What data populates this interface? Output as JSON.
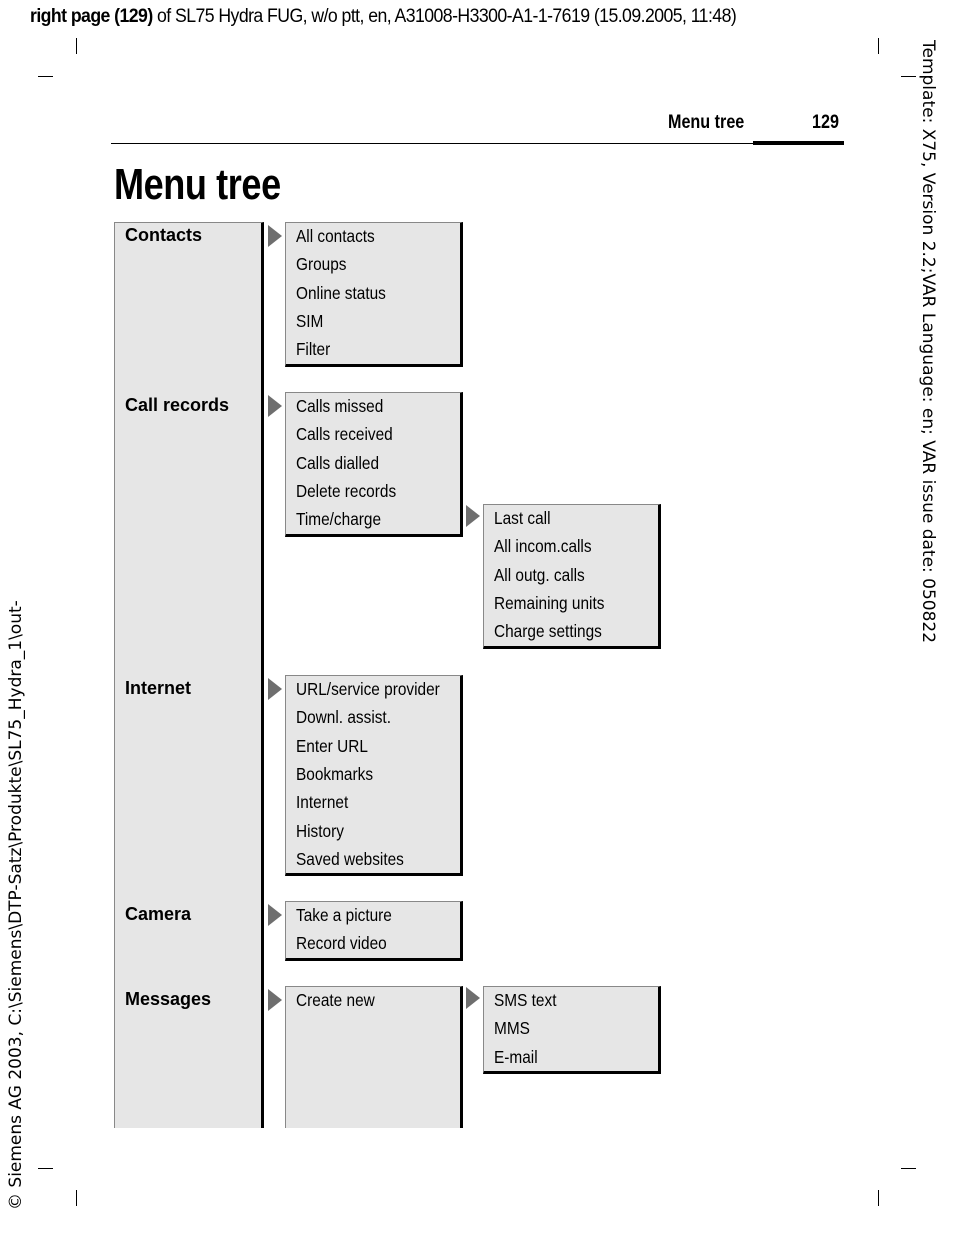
{
  "slug": {
    "bold": "right page (129)",
    "rest": " of SL75 Hydra FUG, w/o ptt, en, A31008-H3300-A1-1-7619 (15.09.2005, 11:48)"
  },
  "side_right": "Template: X75, Version 2.2;VAR Language: en; VAR issue date: 050822",
  "side_left": "© Siemens AG 2003, C:\\Siemens\\DTP-Satz\\Produkte\\SL75_Hydra_1\\out-",
  "running_head": {
    "title": "Menu tree",
    "page": "129"
  },
  "title": "Menu tree",
  "box_color": "#e6e6e6",
  "arrow_color": "#6e6e6e",
  "categories": [
    {
      "label": "Contacts",
      "items": [
        "All contacts",
        "Groups",
        "Online status",
        "SIM",
        "Filter"
      ]
    },
    {
      "label": "Call records",
      "items": [
        "Calls missed",
        "Calls received",
        "Calls dialled",
        "Delete records",
        "Time/charge"
      ],
      "submenu": {
        "parent": "Time/charge",
        "items": [
          "Last call",
          "All incom.calls",
          "All outg. calls",
          "Remaining units",
          "Charge settings"
        ]
      }
    },
    {
      "label": "Internet",
      "items": [
        "URL/service provider",
        "Downl. assist.",
        "Enter URL",
        "Bookmarks",
        "Internet",
        "History",
        "Saved websites"
      ]
    },
    {
      "label": "Camera",
      "items": [
        "Take a picture",
        "Record video"
      ]
    },
    {
      "label": "Messages",
      "items": [
        "Create new"
      ],
      "submenu": {
        "parent": "Create new",
        "items": [
          "SMS text",
          "MMS",
          "E-mail"
        ]
      }
    }
  ]
}
